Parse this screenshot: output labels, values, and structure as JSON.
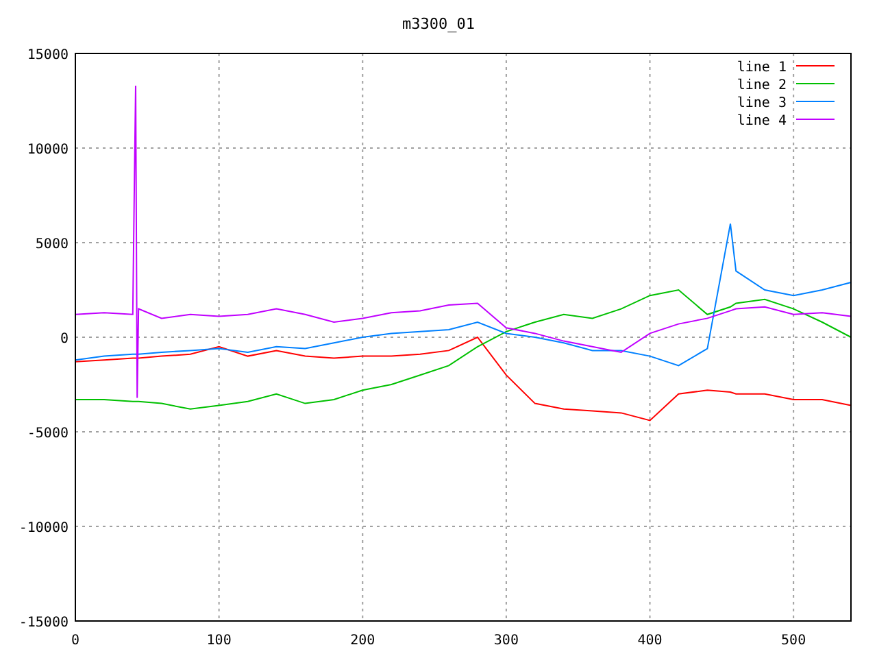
{
  "chart_data": {
    "type": "line",
    "title": "m3300_01",
    "x": [
      0,
      20,
      40,
      41,
      42,
      43,
      44,
      60,
      80,
      100,
      120,
      140,
      160,
      180,
      200,
      220,
      240,
      260,
      280,
      300,
      320,
      340,
      360,
      380,
      400,
      420,
      440,
      456,
      460,
      480,
      500,
      520,
      540
    ],
    "series": [
      {
        "name": "line 1",
        "color": "#ff0000",
        "values": [
          -1300,
          -1200,
          -1100,
          -1100,
          -1100,
          -1100,
          -1100,
          -1000,
          -900,
          -500,
          -1000,
          -700,
          -1000,
          -1100,
          -1000,
          -1000,
          -900,
          -700,
          0,
          -2000,
          -3500,
          -3800,
          -3900,
          -4000,
          -4400,
          -3000,
          -2800,
          -2900,
          -3000,
          -3000,
          -3300,
          -3300,
          -3600
        ]
      },
      {
        "name": "line 2",
        "color": "#00c000",
        "values": [
          -3300,
          -3300,
          -3400,
          -3400,
          -3400,
          -3400,
          -3400,
          -3500,
          -3800,
          -3600,
          -3400,
          -3000,
          -3500,
          -3300,
          -2800,
          -2500,
          -2000,
          -1500,
          -500,
          300,
          800,
          1200,
          1000,
          1500,
          2200,
          2500,
          1200,
          1600,
          1800,
          2000,
          1500,
          800,
          0
        ]
      },
      {
        "name": "line 3",
        "color": "#0080ff",
        "values": [
          -1200,
          -1000,
          -900,
          -900,
          -900,
          -900,
          -900,
          -800,
          -700,
          -600,
          -800,
          -500,
          -600,
          -300,
          0,
          200,
          300,
          400,
          800,
          200,
          0,
          -300,
          -700,
          -700,
          -1000,
          -1500,
          -600,
          6000,
          3500,
          2500,
          2200,
          2500,
          2900
        ]
      },
      {
        "name": "line 4",
        "color": "#c000ff",
        "values": [
          1200,
          1300,
          1200,
          7800,
          13300,
          -3200,
          1500,
          1000,
          1200,
          1100,
          1200,
          1500,
          1200,
          800,
          1000,
          1300,
          1400,
          1700,
          1800,
          500,
          200,
          -200,
          -500,
          -800,
          200,
          700,
          1000,
          1400,
          1500,
          1600,
          1200,
          1300,
          1100
        ]
      }
    ],
    "grid": true,
    "legend": true,
    "xlim": [
      0,
      540
    ],
    "ylim": [
      -15000,
      15000
    ],
    "xticks": [
      0,
      100,
      200,
      300,
      400,
      500
    ],
    "yticks": [
      -15000,
      -10000,
      -5000,
      0,
      5000,
      10000,
      15000
    ]
  }
}
